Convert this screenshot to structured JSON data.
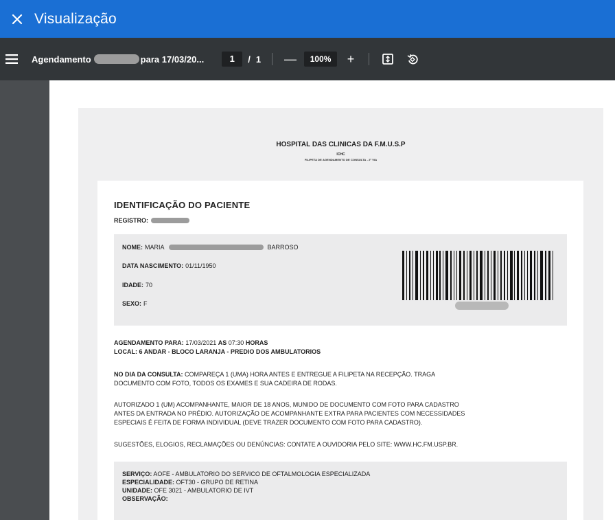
{
  "app": {
    "title": "Visualização"
  },
  "toolbar": {
    "doc_title_prefix": "Agendamento",
    "doc_title_suffix": "para 17/03/20...",
    "current_page": "1",
    "page_separator": "/",
    "total_pages": "1",
    "zoom_minus": "—",
    "zoom_level": "100%",
    "zoom_plus": "+"
  },
  "document": {
    "hospital": "HOSPITAL DAS CLINICAS DA F.M.U.S.P",
    "unit_code": "ICHC",
    "subtitle": "FILIPETA DE AGENDAMENTO DE CONSULTA - 2ª VIA",
    "section_title": "IDENTIFICAÇÃO DO PACIENTE",
    "registro_label": "REGISTRO:",
    "patient": {
      "nome_label": "NOME:",
      "nome_first": "MARIA",
      "nome_last": "BARROSO",
      "nascimento_label": "DATA NASCIMENTO:",
      "nascimento_value": "01/11/1950",
      "idade_label": "IDADE:",
      "idade_value": "70",
      "sexo_label": "SEXO:",
      "sexo_value": "F"
    },
    "agendamento_label": "AGENDAMENTO PARA:",
    "agendamento_date": "17/03/2021",
    "as_label": "AS",
    "agendamento_time": "07:30",
    "horas_label": "HORAS",
    "local_label": "LOCAL:",
    "local_value": "6 ANDAR - BLOCO LARANJA - PREDIO DOS AMBULATORIOS",
    "dia_label": "NO DIA DA CONSULTA:",
    "dia_text_1": "COMPAREÇA 1 (UMA) HORA ANTES E ENTREGUE A FILIPETA NA RECEPÇÃO. TRAGA",
    "dia_text_2": "DOCUMENTO COM FOTO, TODOS OS EXAMES E SUA CADEIRA DE RODAS.",
    "autorizado_1": "AUTORIZADO 1 (UM) ACOMPANHANTE, MAIOR DE 18 ANOS, MUNIDO DE DOCUMENTO COM FOTO PARA CADASTRO",
    "autorizado_2": "ANTES DA ENTRADA NO PRÉDIO. AUTORIZAÇÃO DE ACOMPANHANTE EXTRA PARA PACIENTES COM NECESSIDADES",
    "autorizado_3": "ESPECIAIS É FEITA DE FORMA INDIVIDUAL (DEVE TRAZER DOCUMENTO COM FOTO PARA CADASTRO).",
    "sugestoes": "SUGESTÕES, ELOGIOS, RECLAMAÇÕES OU DENÚNCIAS: CONTATE A OUVIDORIA PELO SITE: WWW.HC.FM.USP.BR.",
    "service": {
      "servico_label": "SERVIÇO:",
      "servico_value": "AOFE - AMBULATORIO DO SERVICO DE OFTALMOLOGIA ESPECIALIZADA",
      "especialidade_label": "ESPECIALIDADE:",
      "especialidade_value": "OFT30 - GRUPO DE RETINA",
      "unidade_label": "UNIDADE:",
      "unidade_value": "OFE 3021 - AMBULATORIO DE IVT",
      "observacao_label": "OBSERVAÇÃO:"
    }
  },
  "colors": {
    "app_bar": "#1a6fd4",
    "toolbar": "#323639",
    "viewer_bg": "#515457"
  },
  "icons": {
    "close": "close-icon",
    "menu": "menu-icon",
    "fit": "fit-page-icon",
    "rotate": "rotate-icon"
  }
}
